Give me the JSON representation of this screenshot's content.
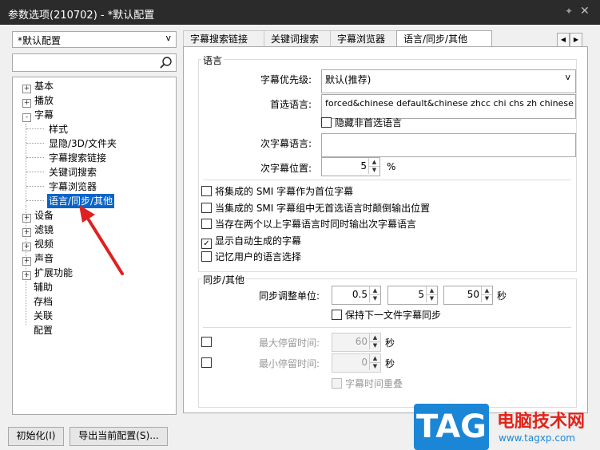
{
  "window": {
    "title": "参数选项(210702) - *默认配置",
    "pin_icon": "pin-icon",
    "close_icon": "close-icon"
  },
  "profile": {
    "value": "*默认配置",
    "arrow": "v"
  },
  "search": {
    "value": "",
    "icon": "search-icon"
  },
  "tree": {
    "basic": {
      "toggle": "+",
      "label": "基本"
    },
    "play": {
      "toggle": "+",
      "label": "播放"
    },
    "subtitle": {
      "toggle": "-",
      "label": "字幕"
    },
    "style": "样式",
    "show_hide": "显隐/3D/文件夹",
    "sub_search_link": "字幕搜索链接",
    "keyword_search": "关键词搜索",
    "sub_browser": "字幕浏览器",
    "lang_sync_other": "语言/同步/其他",
    "device": {
      "toggle": "+",
      "label": "设备"
    },
    "filter": {
      "toggle": "+",
      "label": "滤镜"
    },
    "video": {
      "toggle": "+",
      "label": "视频"
    },
    "audio": {
      "toggle": "+",
      "label": "声音"
    },
    "extensions": {
      "toggle": "+",
      "label": "扩展功能"
    },
    "assist": "辅助",
    "archive": "存档",
    "assoc": "关联",
    "config": "配置"
  },
  "tabs": [
    "字幕搜索链接",
    "关键词搜索",
    "字幕浏览器",
    "语言/同步/其他"
  ],
  "tab_nav": {
    "left": "◀",
    "right": "▶"
  },
  "language_group": {
    "title": "语言",
    "priority_label": "字幕优先级:",
    "priority_value": "默认(推荐)",
    "preferred_label": "首选语言:",
    "preferred_value": "forced&chinese default&chinese zhcc chi chs zh chinese",
    "hide_non_preferred": "隐藏非首选语言",
    "secondary_label": "次字幕语言:",
    "secondary_value": "",
    "secondary_pos_label": "次字幕位置:",
    "secondary_pos_value": "5",
    "secondary_pos_unit": "%",
    "opt1": "将集成的 SMI 字幕作为首位字幕",
    "opt2": "当集成的 SMI 字幕组中无首选语言时颠倒输出位置",
    "opt3": "当存在两个以上字幕语言时同时输出次字幕语言",
    "opt4": "显示自动生成的字幕",
    "opt5": "记忆用户的语言选择",
    "opt4_checked": true
  },
  "sync_group": {
    "title": "同步/其他",
    "adjust_label": "同步调整单位:",
    "adjust_a": "0.5",
    "adjust_b": "5",
    "adjust_c": "50",
    "adjust_unit": "秒",
    "keep_sync": "保持下一文件字幕同步",
    "max_label": "最大停留时间:",
    "max_value": "60",
    "max_unit": "秒",
    "min_label": "最小停留时间:",
    "min_value": "0",
    "min_unit": "秒",
    "overlap": "字幕时间重叠"
  },
  "buttons": {
    "init": "初始化(I)",
    "export": "导出当前配置(S)..."
  },
  "watermark": {
    "tag": "TAG",
    "site_name": "电脑技术网",
    "url": "www.tagxp.com"
  },
  "colors": {
    "selection": "#0a64c8",
    "arrow": "#e02020",
    "titlebar": "#2b2b2b"
  }
}
